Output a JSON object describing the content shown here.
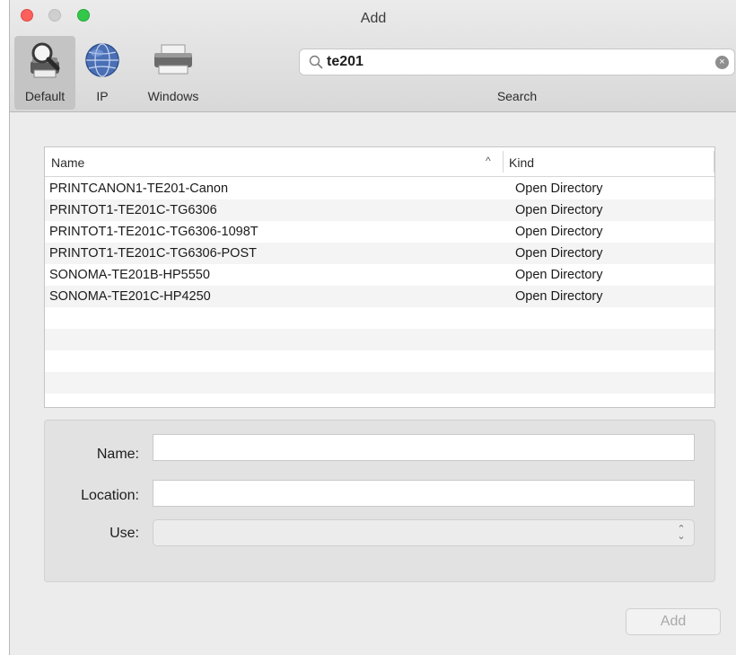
{
  "window": {
    "title": "Add"
  },
  "toolbar": {
    "tools": [
      {
        "label": "Default",
        "icon": "default-printer-magnifier-icon",
        "selected": true
      },
      {
        "label": "IP",
        "icon": "globe-icon",
        "selected": false
      },
      {
        "label": "Windows",
        "icon": "windows-printer-icon",
        "selected": false
      }
    ],
    "search": {
      "value": "te201",
      "caption": "Search",
      "icon": "magnifier-icon",
      "clear_icon": "clear-icon"
    }
  },
  "list": {
    "columns": {
      "name": "Name",
      "kind": "Kind",
      "sort_indicator": "^"
    },
    "rows": [
      {
        "name": "PRINTCANON1-TE201-Canon",
        "kind": "Open Directory"
      },
      {
        "name": "PRINTOT1-TE201C-TG6306",
        "kind": "Open Directory"
      },
      {
        "name": "PRINTOT1-TE201C-TG6306-1098T",
        "kind": "Open Directory"
      },
      {
        "name": "PRINTOT1-TE201C-TG6306-POST",
        "kind": "Open Directory"
      },
      {
        "name": "SONOMA-TE201B-HP5550",
        "kind": "Open Directory"
      },
      {
        "name": "SONOMA-TE201C-HP4250",
        "kind": "Open Directory"
      }
    ]
  },
  "form": {
    "name_label": "Name:",
    "name_value": "",
    "location_label": "Location:",
    "location_value": "",
    "use_label": "Use:",
    "use_value": ""
  },
  "actions": {
    "add_label": "Add"
  },
  "colors": {
    "close": "#fc605c",
    "zoom": "#34c84a",
    "selected_tool": "#c4c4c4"
  }
}
